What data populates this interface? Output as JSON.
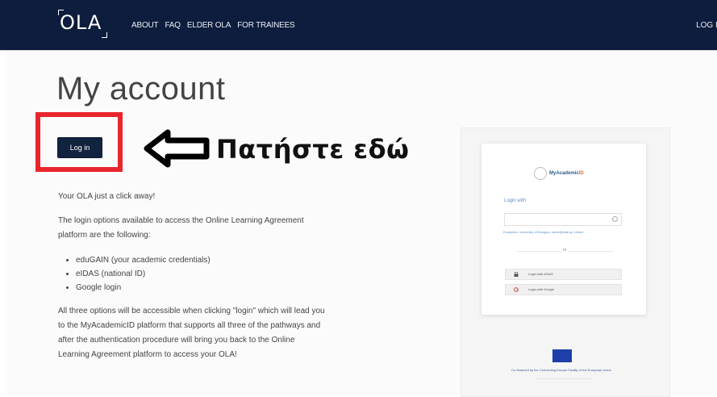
{
  "nav": {
    "logo": "OLA",
    "items": [
      "ABOUT",
      "FAQ",
      "ELDER OLA",
      "FOR TRAINEES"
    ],
    "login_link": "LOG IN"
  },
  "main": {
    "title": "My account",
    "login_button": "Log in",
    "hint": "Πατήστε εδώ",
    "intro": "Your OLA just a click away!",
    "options_text": [
      "The login options available to access the Online Learning Agreement",
      "platform are the following:"
    ],
    "options": [
      "eduGAIN (your academic credentials)",
      "eIDAS (national ID)",
      "Google login"
    ],
    "closing_lines": [
      "All three options will be accessible when clicking \"login\" which will lead you",
      "to the MyAcademicID platform that supports all three of the pathways and",
      "after the authentication procedure will bring you back to the Online",
      "Learning Agreement platform to access your OLA!"
    ]
  },
  "preview": {
    "logo_text_a": "MyAcademic",
    "logo_text_b": "ID",
    "login_with": "Login with",
    "example": "Examples: University of Bologna, name@mail.gr, Unime",
    "or": "or",
    "btn_eidas": "Login with eIDAS",
    "btn_google": "Login with Google",
    "eu_caption": "Co-financed by the Connecting Europe Facility of the European Union"
  },
  "colors": {
    "header": "#0e1d3d",
    "highlight": "#e8262c",
    "button": "#12233f"
  }
}
